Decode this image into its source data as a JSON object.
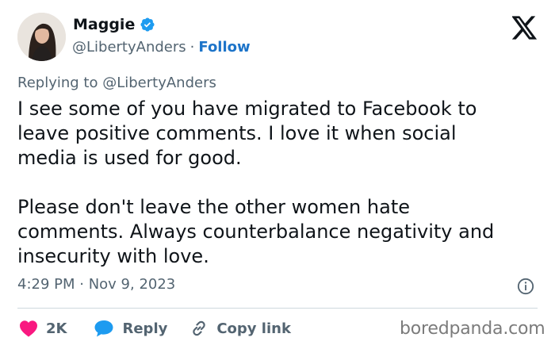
{
  "author": {
    "name": "Maggie",
    "handle": "@LibertyAnders",
    "separator": "·",
    "follow_label": "Follow",
    "verified": true
  },
  "icons": {
    "platform_logo": "x-logo-icon",
    "verified": "verified-badge-icon",
    "info": "info-icon",
    "like": "heart-icon",
    "reply": "reply-bubble-icon",
    "copy_link": "link-icon"
  },
  "reply_context": {
    "prefix": "Replying to",
    "mention": "@LibertyAnders"
  },
  "tweet": {
    "text": "I see some of you have migrated to Facebook to\nleave positive comments. I love it when social\nmedia is used for good.\n\nPlease don't leave the other women hate\ncomments. Always counterbalance negativity and\ninsecurity with love.",
    "timestamp": "4:29 PM · Nov 9, 2023"
  },
  "actions": {
    "like_count": "2K",
    "reply_label": "Reply",
    "copy_link_label": "Copy link"
  },
  "watermark": "boredpanda.com",
  "colors": {
    "text": "#0f1419",
    "muted": "#536471",
    "follow": "#1d74c9",
    "verified": "#1d9bf0",
    "heart": "#f91880",
    "reply": "#1d9bf0",
    "divider": "#cfd9de"
  }
}
